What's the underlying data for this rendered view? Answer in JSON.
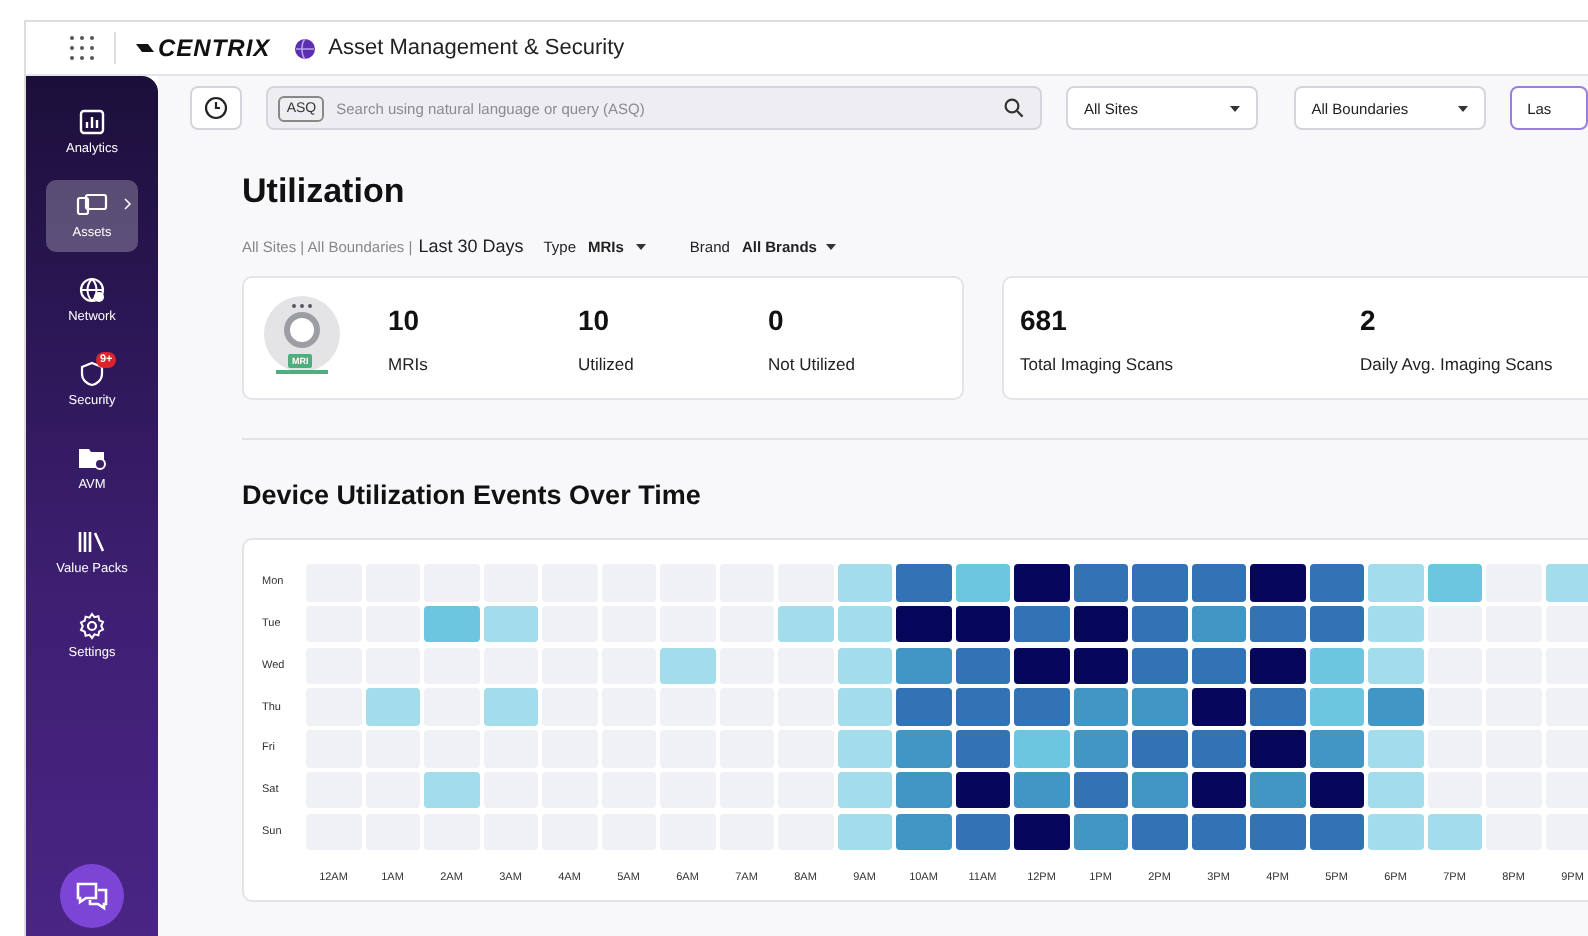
{
  "header": {
    "logo": "CENTRIX",
    "title": "Asset Management & Security"
  },
  "sidebar": {
    "items": [
      {
        "label": "Analytics",
        "selected": false
      },
      {
        "label": "Assets",
        "selected": true
      },
      {
        "label": "Network",
        "selected": false
      },
      {
        "label": "Security",
        "selected": false,
        "badge": "9+"
      },
      {
        "label": "AVM",
        "selected": false
      },
      {
        "label": "Value Packs",
        "selected": false
      },
      {
        "label": "Settings",
        "selected": false
      }
    ]
  },
  "toolbar": {
    "search_tag": "ASQ",
    "search_placeholder": "Search using natural language or query (ASQ)",
    "filters": [
      "All Sites",
      "All Boundaries",
      "Las"
    ]
  },
  "page_title": "Utilization",
  "scope": {
    "path": "All Sites | All Boundaries |",
    "period": "Last 30 Days",
    "type_label": "Type",
    "type_value": "MRIs",
    "brand_label": "Brand",
    "brand_value": "All Brands"
  },
  "summary_cards": [
    {
      "stats": [
        {
          "value": "10",
          "label": "MRIs"
        },
        {
          "value": "10",
          "label": "Utilized"
        },
        {
          "value": "0",
          "label": "Not Utilized"
        }
      ],
      "device_tag": "MRI"
    },
    {
      "stats": [
        {
          "value": "681",
          "label": "Total Imaging Scans"
        },
        {
          "value": "2",
          "label": "Daily Avg. Imaging Scans"
        }
      ]
    }
  ],
  "heatmap": {
    "title": "Device Utilization Events Over Time",
    "hours": [
      "12AM",
      "1AM",
      "2AM",
      "3AM",
      "4AM",
      "5AM",
      "6AM",
      "7AM",
      "8AM",
      "9AM",
      "10AM",
      "11AM",
      "12PM",
      "1PM",
      "2PM",
      "3PM",
      "4PM",
      "5PM",
      "6PM",
      "7PM",
      "8PM",
      "9PM"
    ],
    "rows": [
      {
        "day": "Mon",
        "cells": [
          {
            "color": "#f0f1f5"
          },
          {
            "color": "#f0f1f5"
          },
          {
            "color": "#f0f1f5"
          },
          {
            "color": "#f0f1f5"
          },
          {
            "color": "#f0f1f5"
          },
          {
            "color": "#f0f1f5"
          },
          {
            "color": "#f0f1f5"
          },
          {
            "color": "#f0f1f5"
          },
          {
            "color": "#f0f1f5"
          },
          {
            "color": "#a3dcea"
          },
          {
            "color": "#3273b5"
          },
          {
            "color": "#6cc6e0"
          },
          {
            "color": "#06065a"
          },
          {
            "color": "#3273b5"
          },
          {
            "color": "#3273b5"
          },
          {
            "color": "#3273b5"
          },
          {
            "color": "#06065a"
          },
          {
            "color": "#3273b5"
          },
          {
            "color": "#a3dcea"
          },
          {
            "color": "#6cc6e0"
          },
          {
            "color": "#f0f1f5"
          },
          {
            "color": "#a3dcea"
          }
        ]
      },
      {
        "day": "Tue",
        "cells": [
          {
            "color": "#f0f1f5"
          },
          {
            "color": "#f0f1f5"
          },
          {
            "color": "#6cc6e0"
          },
          {
            "color": "#a3dcea"
          },
          {
            "color": "#f0f1f5"
          },
          {
            "color": "#f0f1f5"
          },
          {
            "color": "#f0f1f5"
          },
          {
            "color": "#f0f1f5"
          },
          {
            "color": "#a3dcea"
          },
          {
            "color": "#a3dcea"
          },
          {
            "color": "#06065a"
          },
          {
            "color": "#06065a"
          },
          {
            "color": "#3273b5"
          },
          {
            "color": "#06065a"
          },
          {
            "color": "#3273b5"
          },
          {
            "color": "#4196c4"
          },
          {
            "color": "#3273b5"
          },
          {
            "color": "#3273b5"
          },
          {
            "color": "#a3dcea"
          },
          {
            "color": "#f0f1f5"
          },
          {
            "color": "#f0f1f5"
          },
          {
            "color": "#f0f1f5"
          }
        ]
      },
      {
        "day": "Wed",
        "cells": [
          {
            "color": "#f0f1f5"
          },
          {
            "color": "#f0f1f5"
          },
          {
            "color": "#f0f1f5"
          },
          {
            "color": "#f0f1f5"
          },
          {
            "color": "#f0f1f5"
          },
          {
            "color": "#f0f1f5"
          },
          {
            "color": "#a3dcea"
          },
          {
            "color": "#f0f1f5"
          },
          {
            "color": "#f0f1f5"
          },
          {
            "color": "#a3dcea"
          },
          {
            "color": "#4196c4"
          },
          {
            "color": "#3273b5"
          },
          {
            "color": "#06065a"
          },
          {
            "color": "#06065a"
          },
          {
            "color": "#3273b5"
          },
          {
            "color": "#3273b5"
          },
          {
            "color": "#06065a"
          },
          {
            "color": "#6cc6e0"
          },
          {
            "color": "#a3dcea"
          },
          {
            "color": "#f0f1f5"
          },
          {
            "color": "#f0f1f5"
          },
          {
            "color": "#f0f1f5"
          }
        ]
      },
      {
        "day": "Thu",
        "cells": [
          {
            "color": "#f0f1f5"
          },
          {
            "color": "#a3dcea"
          },
          {
            "color": "#f0f1f5"
          },
          {
            "color": "#a3dcea"
          },
          {
            "color": "#f0f1f5"
          },
          {
            "color": "#f0f1f5"
          },
          {
            "color": "#f0f1f5"
          },
          {
            "color": "#f0f1f5"
          },
          {
            "color": "#f0f1f5"
          },
          {
            "color": "#a3dcea"
          },
          {
            "color": "#3273b5"
          },
          {
            "color": "#3273b5"
          },
          {
            "color": "#3273b5"
          },
          {
            "color": "#4196c4"
          },
          {
            "color": "#4196c4"
          },
          {
            "color": "#06065a"
          },
          {
            "color": "#3273b5"
          },
          {
            "color": "#6cc6e0"
          },
          {
            "color": "#4196c4"
          },
          {
            "color": "#f0f1f5"
          },
          {
            "color": "#f0f1f5"
          },
          {
            "color": "#f0f1f5"
          }
        ]
      },
      {
        "day": "Fri",
        "cells": [
          {
            "color": "#f0f1f5"
          },
          {
            "color": "#f0f1f5"
          },
          {
            "color": "#f0f1f5"
          },
          {
            "color": "#f0f1f5"
          },
          {
            "color": "#f0f1f5"
          },
          {
            "color": "#f0f1f5"
          },
          {
            "color": "#f0f1f5"
          },
          {
            "color": "#f0f1f5"
          },
          {
            "color": "#f0f1f5"
          },
          {
            "color": "#a3dcea"
          },
          {
            "color": "#4196c4"
          },
          {
            "color": "#3273b5"
          },
          {
            "color": "#6cc6e0"
          },
          {
            "color": "#4196c4"
          },
          {
            "color": "#3273b5"
          },
          {
            "color": "#3273b5"
          },
          {
            "color": "#06065a"
          },
          {
            "color": "#4196c4"
          },
          {
            "color": "#a3dcea"
          },
          {
            "color": "#f0f1f5"
          },
          {
            "color": "#f0f1f5"
          },
          {
            "color": "#f0f1f5"
          }
        ]
      },
      {
        "day": "Sat",
        "cells": [
          {
            "color": "#f0f1f5"
          },
          {
            "color": "#f0f1f5"
          },
          {
            "color": "#a3dcea"
          },
          {
            "color": "#f0f1f5"
          },
          {
            "color": "#f0f1f5"
          },
          {
            "color": "#f0f1f5"
          },
          {
            "color": "#f0f1f5"
          },
          {
            "color": "#f0f1f5"
          },
          {
            "color": "#f0f1f5"
          },
          {
            "color": "#a3dcea"
          },
          {
            "color": "#4196c4"
          },
          {
            "color": "#06065a"
          },
          {
            "color": "#4196c4"
          },
          {
            "color": "#3273b5"
          },
          {
            "color": "#4196c4"
          },
          {
            "color": "#06065a"
          },
          {
            "color": "#4196c4"
          },
          {
            "color": "#06065a"
          },
          {
            "color": "#a3dcea"
          },
          {
            "color": "#f0f1f5"
          },
          {
            "color": "#f0f1f5"
          },
          {
            "color": "#f0f1f5"
          }
        ]
      },
      {
        "day": "Sun",
        "cells": [
          {
            "color": "#f0f1f5"
          },
          {
            "color": "#f0f1f5"
          },
          {
            "color": "#f0f1f5"
          },
          {
            "color": "#f0f1f5"
          },
          {
            "color": "#f0f1f5"
          },
          {
            "color": "#f0f1f5"
          },
          {
            "color": "#f0f1f5"
          },
          {
            "color": "#f0f1f5"
          },
          {
            "color": "#f0f1f5"
          },
          {
            "color": "#a3dcea"
          },
          {
            "color": "#4196c4"
          },
          {
            "color": "#3273b5"
          },
          {
            "color": "#06065a"
          },
          {
            "color": "#4196c4"
          },
          {
            "color": "#3273b5"
          },
          {
            "color": "#3273b5"
          },
          {
            "color": "#3273b5"
          },
          {
            "color": "#3273b5"
          },
          {
            "color": "#a3dcea"
          },
          {
            "color": "#a3dcea"
          },
          {
            "color": "#f0f1f5"
          },
          {
            "color": "#f0f1f5"
          }
        ]
      }
    ]
  }
}
